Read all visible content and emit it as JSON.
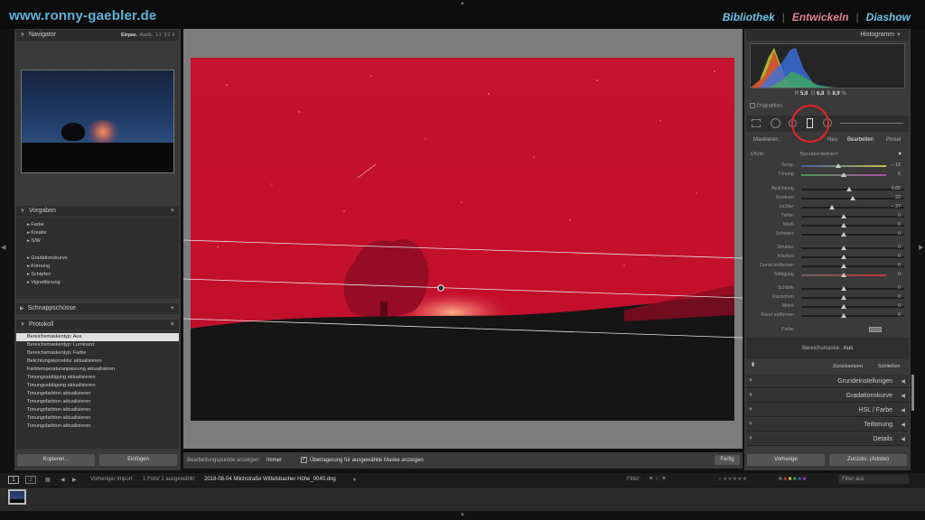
{
  "site": "www.ronny-gaebler.de",
  "modules": {
    "library": "Bibliothek",
    "develop": "Entwickeln",
    "slideshow": "Diashow"
  },
  "navigator": {
    "title": "Navigator",
    "options": [
      "Einpas.",
      "Ausfü.",
      "1:1",
      "3:1"
    ]
  },
  "presets": {
    "title": "Vorgaben",
    "group1": [
      "Farbe",
      "Kreativ",
      "S/W"
    ],
    "group2": [
      "Gradationskurve",
      "Körnung",
      "Schärfen",
      "Vignettierung"
    ]
  },
  "snapshots": {
    "title": "Schnappschüsse"
  },
  "history": {
    "title": "Protokoll",
    "items": [
      "Bereichsmaskentyp: Aus",
      "Bereichsmaskentyp: Luminanz",
      "Bereichsmaskentyp: Farbe",
      "Belichtungskorrektur aktualisieren",
      "Farbtemperaturanpassung aktualisieren",
      "Tonungssättigung aktualisieren",
      "Tonungssättigung aktualisieren",
      "Tonungsfarbton aktualisieren",
      "Tonungsfarbton aktualisieren",
      "Tonungsfarbton aktualisieren",
      "Tonungsfarbton aktualisieren",
      "Tonungsfarbton aktualisieren"
    ]
  },
  "left_buttons": {
    "copy": "Kopieren...",
    "paste": "Einfügen"
  },
  "toolbar": {
    "show_pins_label": "Bearbeitungspunkte anzeigen:",
    "show_pins_value": "Immer",
    "overlay_label": "Überlagerung für ausgewählte Maske anzeigen",
    "done": "Fertig"
  },
  "histogram": {
    "title": "Histogramm",
    "r_label": "R",
    "r": "5,8",
    "g_label": "G",
    "g": "6,8",
    "b_label": "B",
    "b": "8,9",
    "unit": "%",
    "original": "Originalfoto"
  },
  "mask": {
    "title": "Maskieren :",
    "new": "Neu",
    "edit": "Bearbeiten",
    "brush": "Pinsel"
  },
  "effect": {
    "label": "Effekt :",
    "value": "Benutzerdefiniert"
  },
  "sliders": [
    {
      "label": "Temp.",
      "value": "− 15",
      "pos": 0.44
    },
    {
      "label": "Tönung",
      "value": "0",
      "pos": 0.5
    },
    {
      "label": "Belichtung",
      "value": "0,65",
      "pos": 0.56
    },
    {
      "label": "Kontrast",
      "value": "22",
      "pos": 0.61
    },
    {
      "label": "Lichter",
      "value": "− 27",
      "pos": 0.36
    },
    {
      "label": "Tiefen",
      "value": "0",
      "pos": 0.5
    },
    {
      "label": "Weiß",
      "value": "0",
      "pos": 0.5
    },
    {
      "label": "Schwarz",
      "value": "0",
      "pos": 0.5
    },
    {
      "label": "Struktur",
      "value": "0",
      "pos": 0.5
    },
    {
      "label": "Klarheit",
      "value": "0",
      "pos": 0.5
    },
    {
      "label": "Dunst entfernen",
      "value": "0",
      "pos": 0.5
    },
    {
      "label": "Sättigung",
      "value": "0",
      "pos": 0.5
    },
    {
      "label": "Schärfe",
      "value": "0",
      "pos": 0.5
    },
    {
      "label": "Rauschen",
      "value": "0",
      "pos": 0.5
    },
    {
      "label": "Moiré",
      "value": "0",
      "pos": 0.5
    },
    {
      "label": "Rand entfernen",
      "value": "0",
      "pos": 0.5
    }
  ],
  "color_label": "Farbe",
  "range_mask": {
    "label": "Bereichsmaske :",
    "value": "Aus"
  },
  "reset": "Zurücksetzen",
  "close": "Schließen",
  "sections": [
    "Grundeinstellungen",
    "Gradationskurve",
    "HSL / Farbe",
    "Teiltonung",
    "Details"
  ],
  "right_buttons": {
    "previous": "Vorherige",
    "reset": "Zurücks. (Adobe)"
  },
  "filmstrip": {
    "prev_import": "Vorheriger Import",
    "count": "1 Foto/ 1 ausgewählt/",
    "filename": "2018-08-04 Milchstraße Wittelsbacher Höhe_0040.dng",
    "filter_label": "Filter:",
    "filter_value": "Filter aus",
    "page1": "1",
    "page2": "2"
  },
  "colors": {
    "mask_red": "#c8102e",
    "accent_red": "#e8232e"
  }
}
